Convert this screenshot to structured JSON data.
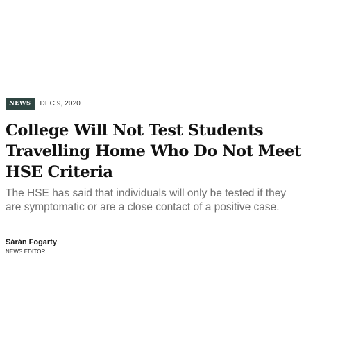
{
  "article": {
    "category": "NEWS",
    "date": "DEC 9, 2020",
    "headline": "College Will Not Test Students Travelling Home Who Do Not Meet HSE Criteria",
    "subheadline": "The HSE has said that individuals will only be tested if they are symptomatic or are a close contact of a positive case.",
    "author": {
      "name": "Sárán Fogarty",
      "role": "NEWS EDITOR"
    }
  },
  "colors": {
    "badge_background": "#2f4642",
    "headline": "#111111",
    "subheadline": "#6f6f6f"
  }
}
